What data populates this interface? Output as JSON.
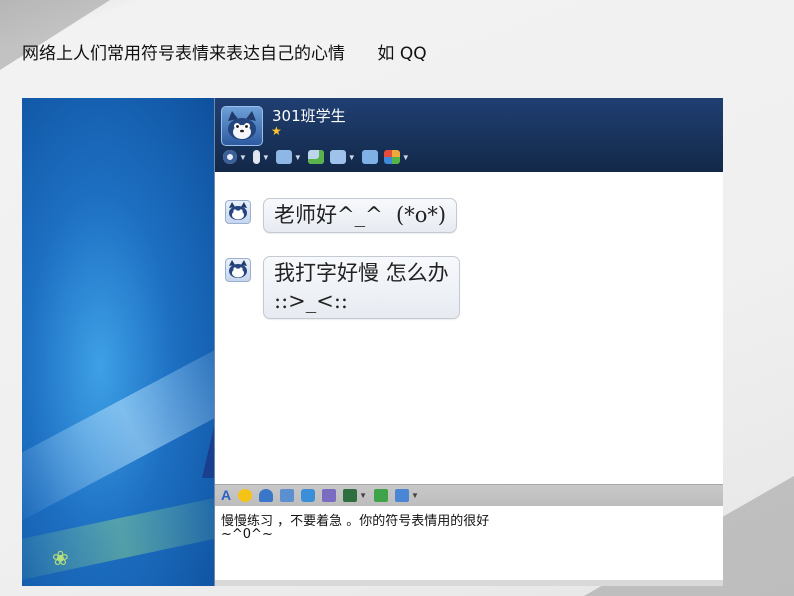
{
  "slide": {
    "title": "网络上人们常用符号表情来表达自己的心情      如 QQ"
  },
  "qq_window": {
    "group_name": "301班学生",
    "top_toolbar": [
      {
        "icon": "eye-icon",
        "color": "#e8eef8"
      },
      {
        "icon": "microphone-icon",
        "color": "#dfe6ef"
      },
      {
        "icon": "folder-icon",
        "color": "#8fb7e6"
      },
      {
        "icon": "chat-add-icon",
        "color": "#bcd6ee"
      },
      {
        "icon": "screen-share-icon",
        "color": "#9ec2ea"
      },
      {
        "icon": "monitor-icon",
        "color": "#7fb1e6"
      },
      {
        "icon": "apps-icon",
        "color": "#f0a93b"
      }
    ],
    "messages": [
      {
        "text": "老师好^_^  (*o*)"
      },
      {
        "text_line1": "我打字好慢 怎么办",
        "text_line2": "::>_<::"
      }
    ],
    "input_toolbar": [
      {
        "icon": "font-icon",
        "color": "#2b62c4"
      },
      {
        "icon": "emoji-icon",
        "color": "#f5c316"
      },
      {
        "icon": "bell-shake-icon",
        "color": "#3a77c8"
      },
      {
        "icon": "blackboard-icon",
        "color": "#5b8fd0"
      },
      {
        "icon": "voice-message-icon",
        "color": "#3a8fd8"
      },
      {
        "icon": "handwriting-icon",
        "color": "#7a6cc0"
      },
      {
        "icon": "image-icon",
        "color": "#2f6f3f"
      },
      {
        "icon": "music-icon",
        "color": "#3fa34a"
      },
      {
        "icon": "screenshot-icon",
        "color": "#4b86d6"
      }
    ],
    "input_text_line1": "慢慢练习 ，不要着急 。你的符号表情用的很好",
    "input_text_line2": "~^0^~"
  }
}
